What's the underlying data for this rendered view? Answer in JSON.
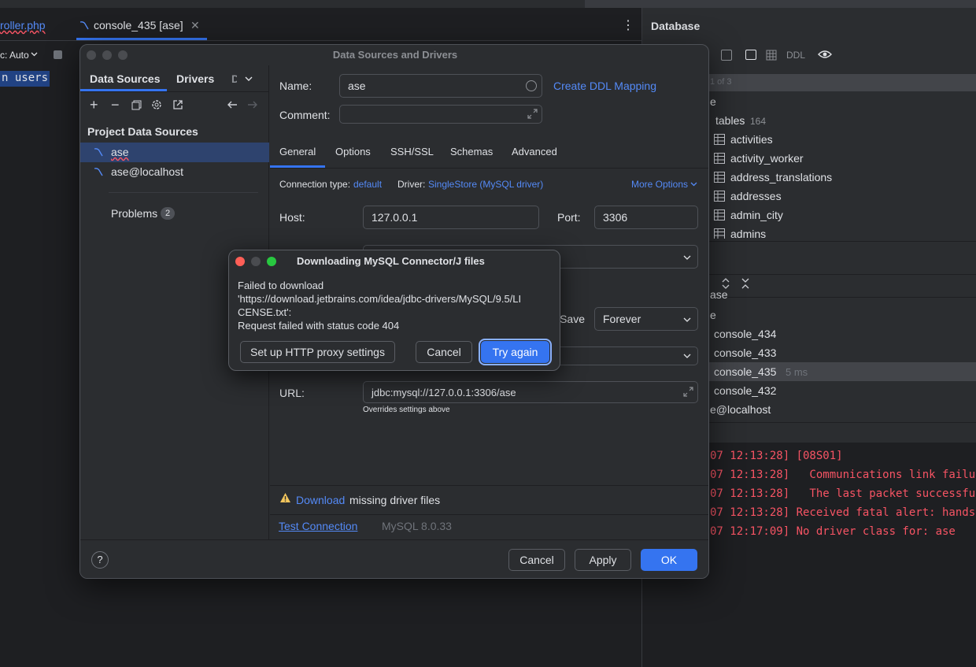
{
  "editor": {
    "tab_prev": "roller.php",
    "tab_active": "console_435 [ase]",
    "toolbar_mode": "c: Auto",
    "code_line": "n users"
  },
  "db_panel": {
    "title": "Database",
    "ddl_label": "DDL",
    "counter": "1 of 3",
    "schema_partial": "e",
    "tables_label": "tables",
    "tables_count": "164",
    "tables": [
      "activities",
      "activity_worker",
      "address_translations",
      "addresses",
      "admin_city",
      "admins"
    ],
    "partial_row": "ase",
    "partial_row2": "e",
    "consoles": [
      {
        "name": "console_434",
        "time": ""
      },
      {
        "name": "console_433",
        "time": ""
      },
      {
        "name": "console_435",
        "time": "5 ms"
      },
      {
        "name": "console_432",
        "time": ""
      }
    ],
    "localhost": "e@localhost",
    "log": [
      "07 12:13:28] [08S01]",
      "07 12:13:28]   Communications link failu",
      "07 12:13:28]   The last packet successfu",
      "07 12:13:28] Received fatal alert: hands",
      "07 12:17:09] No driver class for: ase"
    ]
  },
  "dialog": {
    "title": "Data Sources and Drivers",
    "left_tabs": [
      "Data Sources",
      "Drivers",
      "D"
    ],
    "section_title": "Project Data Sources",
    "sources": [
      "ase",
      "ase@localhost"
    ],
    "problems_label": "Problems",
    "problems_count": "2",
    "name_label": "Name:",
    "name_value": "ase",
    "comment_label": "Comment:",
    "create_ddl": "Create DDL Mapping",
    "tabs": [
      "General",
      "Options",
      "SSH/SSL",
      "Schemas",
      "Advanced"
    ],
    "conn_type_label": "Connection type:",
    "conn_type_value": "default",
    "driver_label": "Driver:",
    "driver_value": "SingleStore (MySQL driver)",
    "more_options": "More Options",
    "host_label": "Host:",
    "host_value": "127.0.0.1",
    "port_label": "Port:",
    "port_value": "3306",
    "save_label": "Save:",
    "save_value": "Forever",
    "url_label": "URL:",
    "url_value": "jdbc:mysql://127.0.0.1:3306/ase",
    "url_note": "Overrides settings above",
    "download_link": "Download",
    "download_rest": "missing driver files",
    "test_connection": "Test Connection",
    "mysql_version": "MySQL 8.0.33",
    "cancel": "Cancel",
    "apply": "Apply",
    "ok": "OK"
  },
  "modal": {
    "title": "Downloading MySQL Connector/J files",
    "message_l1": "Failed to download",
    "message_l2": "'https://download.jetbrains.com/idea/jdbc-drivers/MySQL/9.5/LI",
    "message_l3": "CENSE.txt':",
    "message_l4": "Request failed with status code 404",
    "proxy_button": "Set up HTTP proxy settings",
    "cancel_button": "Cancel",
    "try_again_button": "Try again"
  },
  "colors": {
    "accent": "#3574f0",
    "link": "#548af7",
    "error": "#f75464",
    "warning": "#f2c55c"
  }
}
